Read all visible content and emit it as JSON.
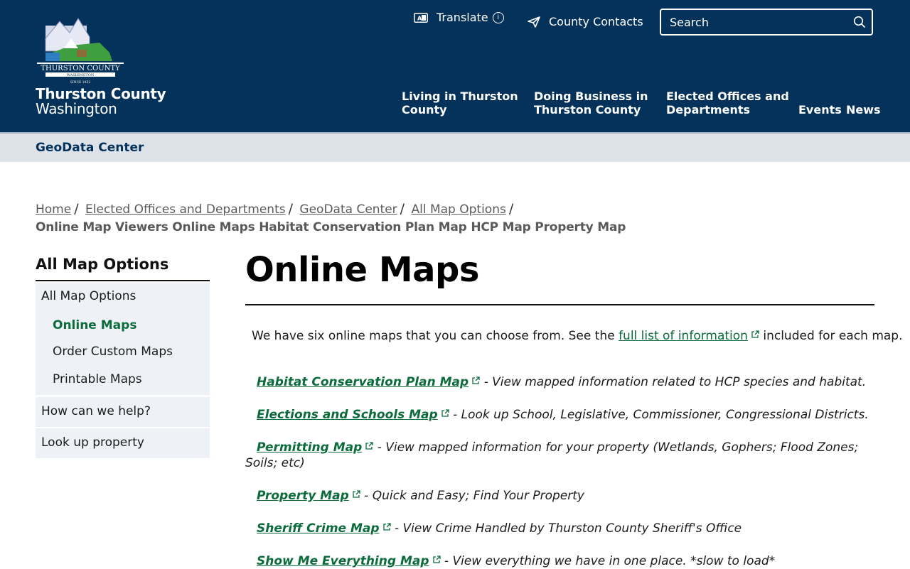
{
  "header": {
    "logo_alt": "THURSTON COUNTY WASHINGTON SINCE 1852",
    "site_name": "Thurston County",
    "site_sub": "Washington",
    "translate": "Translate",
    "contacts": "County Contacts",
    "search_placeholder": "Search",
    "nav": [
      {
        "line1": "Living in Thurston",
        "line2": "County"
      },
      {
        "line1": "Doing Business in",
        "line2": "Thurston County"
      },
      {
        "line1": "Elected Offices and",
        "line2": "Departments"
      },
      {
        "line1": "Events",
        "line2": ""
      },
      {
        "line1": "News",
        "line2": ""
      }
    ]
  },
  "subbar": {
    "title": "GeoData Center"
  },
  "breadcrumb": {
    "items": [
      "Home",
      "Elected Offices and Departments",
      "GeoData Center",
      "All Map Options"
    ],
    "current": "Online Map Viewers Online Maps Habitat Conservation Plan Map HCP Map Property Map"
  },
  "sidebar": {
    "title": "All Map Options",
    "group_label": "All Map Options",
    "sub_items": [
      "Online Maps",
      "Order Custom Maps",
      "Printable Maps"
    ],
    "items": [
      "How can we help?",
      "Look up property"
    ]
  },
  "main": {
    "title": "Online Maps",
    "intro_before": "We have six online maps that you can choose from. See the ",
    "intro_link": "full list of information",
    "intro_after": " included for each map.",
    "maps": [
      {
        "name": "Habitat Conservation Plan Map",
        "desc": " - View mapped information related to HCP species and habitat."
      },
      {
        "name": "Elections and Schools Map",
        "desc": " - Look up School, Legislative, Commissioner, Congressional Districts."
      },
      {
        "name": "Permitting Map",
        "desc": " - View mapped information for your property (Wetlands, Gophers; Flood Zones; Soils; etc)"
      },
      {
        "name": "Property Map",
        "desc": " - Quick and Easy; Find Your Property"
      },
      {
        "name": "Sheriff Crime Map",
        "desc": " - View Crime Handled by Thurston County Sheriff's Office"
      },
      {
        "name": "Show Me Everything Map",
        "desc": " - View everything we have in one place. *slow to load*"
      }
    ]
  },
  "colors": {
    "header_bg": "#04325a",
    "link_green": "#0b6b3a",
    "subbar_bg": "#dde3e9",
    "sidebar_bg": "#eef2f6"
  }
}
